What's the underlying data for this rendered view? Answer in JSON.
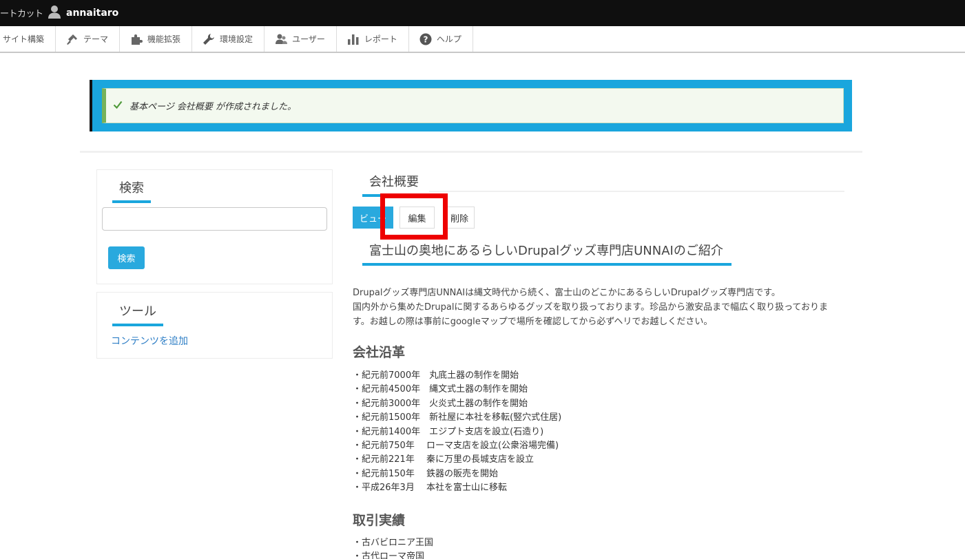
{
  "topbar": {
    "shortcut_label": "ートカット",
    "username": "annaitaro"
  },
  "tray": {
    "items": [
      {
        "label": "サイト構築",
        "icon": "none"
      },
      {
        "label": "テーマ",
        "icon": "paintbrush-icon"
      },
      {
        "label": "機能拡張",
        "icon": "puzzle-icon"
      },
      {
        "label": "環境設定",
        "icon": "wrench-icon"
      },
      {
        "label": "ユーザー",
        "icon": "people-icon"
      },
      {
        "label": "レポート",
        "icon": "bar-chart-icon"
      },
      {
        "label": "ヘルプ",
        "icon": "help-icon"
      }
    ]
  },
  "status": {
    "message": "基本ページ 会社概要 が作成されました。",
    "color_border": "#1aa6dd",
    "color_success": "#77b259"
  },
  "sidebar": {
    "search_title": "検索",
    "search_button": "検索",
    "tools_title": "ツール",
    "tools_link": "コンテンツを追加"
  },
  "main": {
    "page_title": "会社概要",
    "tabs": {
      "view": "ビュー",
      "edit": "編集",
      "delete": "削除"
    },
    "subtitle": "富士山の奥地にあるらしいDrupalグッズ専門店UNNAIのご紹介",
    "intro_line1": "Drupalグッズ専門店UNNAIは縄文時代から続く、富士山のどこかにあるらしいDrupalグッズ専門店です。",
    "intro_line2": "国内外から集めたDrupalに関するあらゆるグッズを取り扱っております。珍品から激安品まで幅広く取り扱っておりま",
    "intro_line3": "す。お越しの際は事前にgoogleマップで場所を確認してから必ずヘリでお越しください。",
    "history_heading": "会社沿革",
    "history": [
      "・紀元前7000年　丸底土器の制作を開始",
      "・紀元前4500年　縄文式土器の制作を開始",
      "・紀元前3000年　火炎式土器の制作を開始",
      "・紀元前1500年　新社屋に本社を移転(竪穴式住居)",
      "・紀元前1400年　エジプト支店を設立(石造り)",
      "・紀元前750年　 ローマ支店を設立(公衆浴場完備)",
      "・紀元前221年　 秦に万里の長城支店を設立",
      "・紀元前150年　 鉄器の販売を開始",
      "・平成26年3月　 本社を富士山に移転"
    ],
    "results_heading": "取引実績",
    "results": [
      "・古バビロニア王国",
      "・古代ローマ帝国"
    ]
  },
  "colors": {
    "accent": "#1aa6dd",
    "highlight": "#ee0000",
    "link": "#2f7fc6"
  }
}
